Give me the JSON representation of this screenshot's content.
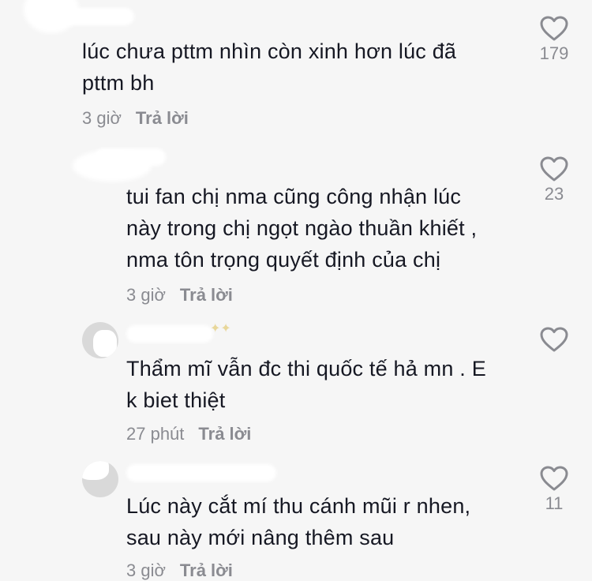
{
  "comments": [
    {
      "text": "lúc chưa pttm nhìn còn xinh hơn lúc đã\npttm bh",
      "time": "3 giờ",
      "reply": "Trả lời",
      "likes": "179"
    },
    {
      "text": "tui fan chị nma cũng công nhận lúc\nnày trong chị ngọt ngào thuần khiết ,\nnma tôn trọng quyết định của chị",
      "time": "3 giờ",
      "reply": "Trả lời",
      "likes": "23"
    },
    {
      "text": "Thẩm mĩ vẫn đc thi quốc tế hả mn . E\nk biet thiệt",
      "time": "27 phút",
      "reply": "Trả lời",
      "likes": ""
    },
    {
      "text": "Lúc này cắt mí thu cánh mũi r nhen,\nsau này mới nâng thêm sau",
      "time": "3 giờ",
      "reply": "Trả lời",
      "likes": "11"
    }
  ],
  "icons": {
    "like": "heart-outline-icon",
    "avatar": "user-avatar"
  },
  "colors": {
    "text": "#161823",
    "meta": "#8a8b91",
    "background": "#f6f6f6"
  }
}
